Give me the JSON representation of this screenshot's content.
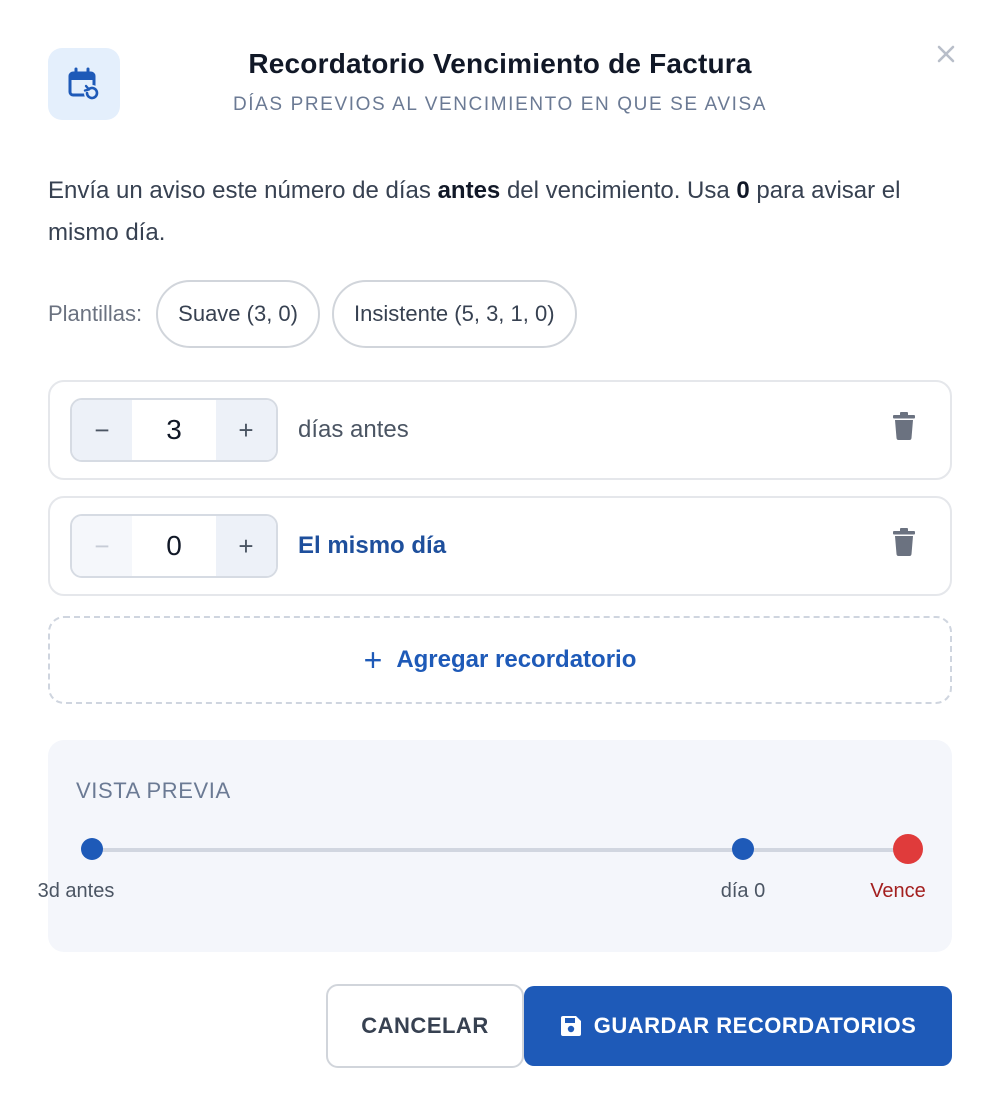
{
  "header": {
    "icon": "calendar-refresh-icon",
    "title": "Recordatorio Vencimiento de Factura",
    "subtitle": "DÍAS PREVIOS AL VENCIMIENTO EN QUE SE AVISA"
  },
  "description": {
    "part1": "Envía un aviso este número de días ",
    "bold1": "antes",
    "part2": " del vencimiento. Usa ",
    "bold2": "0",
    "part3": " para avisar el mismo día."
  },
  "templates": {
    "label": "Plantillas:",
    "items": [
      {
        "label": "Suave (3, 0)"
      },
      {
        "label": "Insistente (5, 3, 1, 0)"
      }
    ]
  },
  "reminders": [
    {
      "decrement": "−",
      "value": "3",
      "increment": "+",
      "label": "días antes",
      "decrement_disabled": false
    },
    {
      "decrement": "−",
      "value": "0",
      "increment": "+",
      "label": "El mismo día",
      "decrement_disabled": true
    }
  ],
  "add_button": {
    "icon": "+",
    "label": "Agregar recordatorio"
  },
  "preview": {
    "title": "VISTA PREVIA",
    "points": [
      {
        "label": "3d antes"
      },
      {
        "label": "día 0"
      },
      {
        "label": "Vence"
      }
    ]
  },
  "actions": {
    "cancel_label": "CANCELAR",
    "save_label": "GUARDAR RECORDATORIOS",
    "save_icon": "floppy-disk-icon"
  },
  "colors": {
    "primary": "#1e5ab8",
    "due": "#e03b3b",
    "due_text": "#a31f1f",
    "icon_bg": "#e4effc"
  }
}
